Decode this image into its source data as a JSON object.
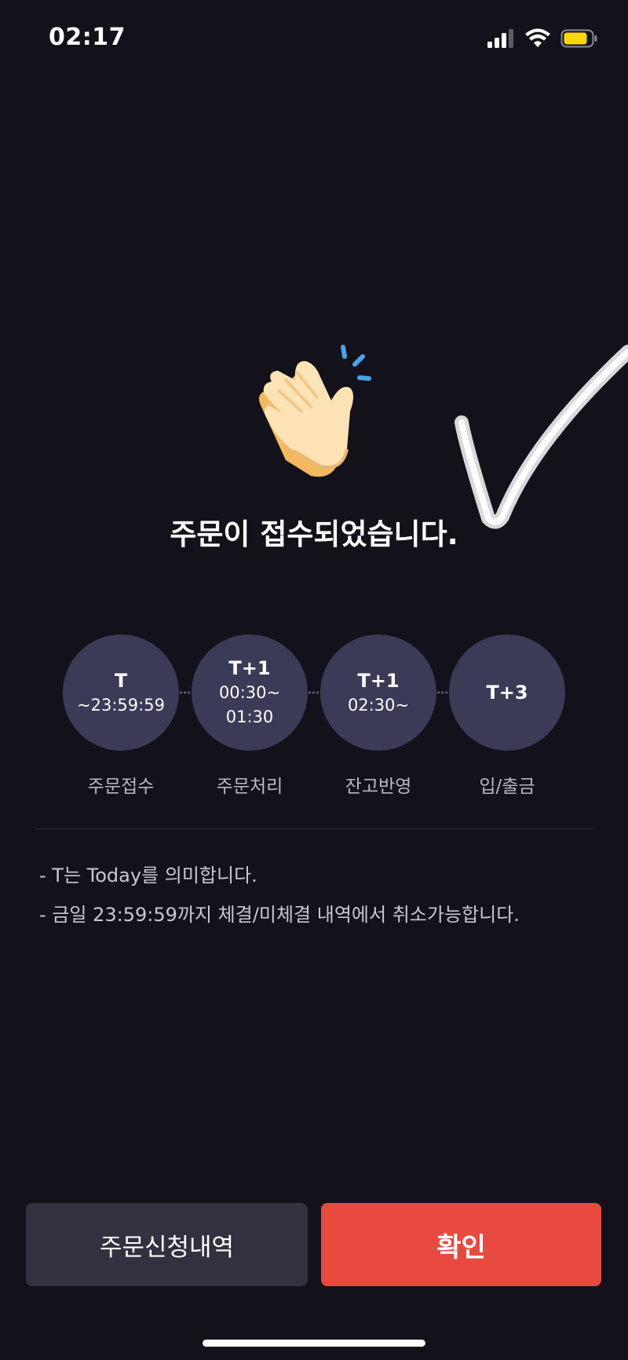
{
  "status_bar": {
    "time": "02:17",
    "icons": [
      "signal-icon",
      "wifi-icon",
      "battery-icon"
    ],
    "battery_color": "#ffd60a"
  },
  "headline": "주문이 접수되었습니다.",
  "timeline": [
    {
      "title": "T",
      "time": "~23:59:59",
      "label": "주문접수"
    },
    {
      "title": "T+1",
      "time": "00:30~\n01:30",
      "label": "주문처리"
    },
    {
      "title": "T+1",
      "time": "02:30~",
      "label": "잔고반영"
    },
    {
      "title": "T+3",
      "time": "",
      "label": "입/출금"
    }
  ],
  "notes": [
    "- T는 Today를 의미합니다.",
    "- 금일 23:59:59까지 체결/미체결 내역에서 취소가능합니다."
  ],
  "buttons": {
    "history_label": "주문신청내역",
    "confirm_label": "확인"
  },
  "colors": {
    "background": "#13121a",
    "step_circle": "#3b3a57",
    "confirm": "#e94a40",
    "secondary_button": "#32313f"
  }
}
